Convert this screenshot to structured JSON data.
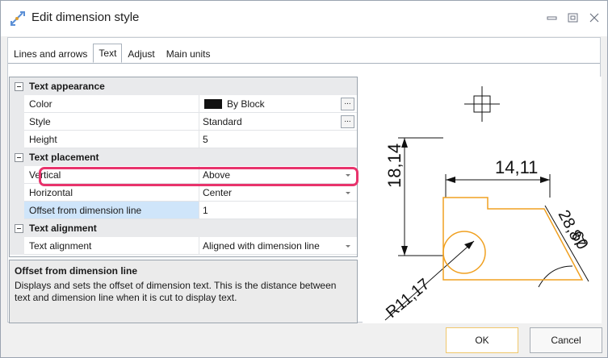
{
  "window": {
    "title": "Edit dimension style"
  },
  "tabs": [
    {
      "label": "Lines and arrows",
      "active": false
    },
    {
      "label": "Text",
      "active": true
    },
    {
      "label": "Adjust",
      "active": false
    },
    {
      "label": "Main units",
      "active": false
    }
  ],
  "grid": {
    "categories": {
      "appearance": "Text appearance",
      "placement": "Text placement",
      "alignment": "Text alignment"
    },
    "color": {
      "label": "Color",
      "value": "By Block",
      "swatch": "#111111"
    },
    "style": {
      "label": "Style",
      "value": "Standard"
    },
    "height": {
      "label": "Height",
      "value": "5"
    },
    "vertical": {
      "label": "Vertical",
      "value": "Above"
    },
    "horizontal": {
      "label": "Horizontal",
      "value": "Center"
    },
    "offset": {
      "label": "Offset from dimension line",
      "value": "1"
    },
    "text_alignment": {
      "label": "Text alignment",
      "value": "Aligned with dimension line"
    },
    "ellipsis": "..."
  },
  "description": {
    "title": "Offset from dimension line",
    "text": "Displays and sets the offset of dimension text. This is the distance between text and dimension line when it is cut to display text."
  },
  "preview": {
    "dim_vertical": "18,14",
    "dim_horizontal": "14,11",
    "dim_radius": "R11,17",
    "dim_angled_a": "28,87",
    "dim_angled_b": "60",
    "part_color": "#f0a020"
  },
  "buttons": {
    "ok": "OK",
    "cancel": "Cancel"
  },
  "colors": {
    "highlight": "#e8336c",
    "selected_row": "#cfe5fa"
  }
}
